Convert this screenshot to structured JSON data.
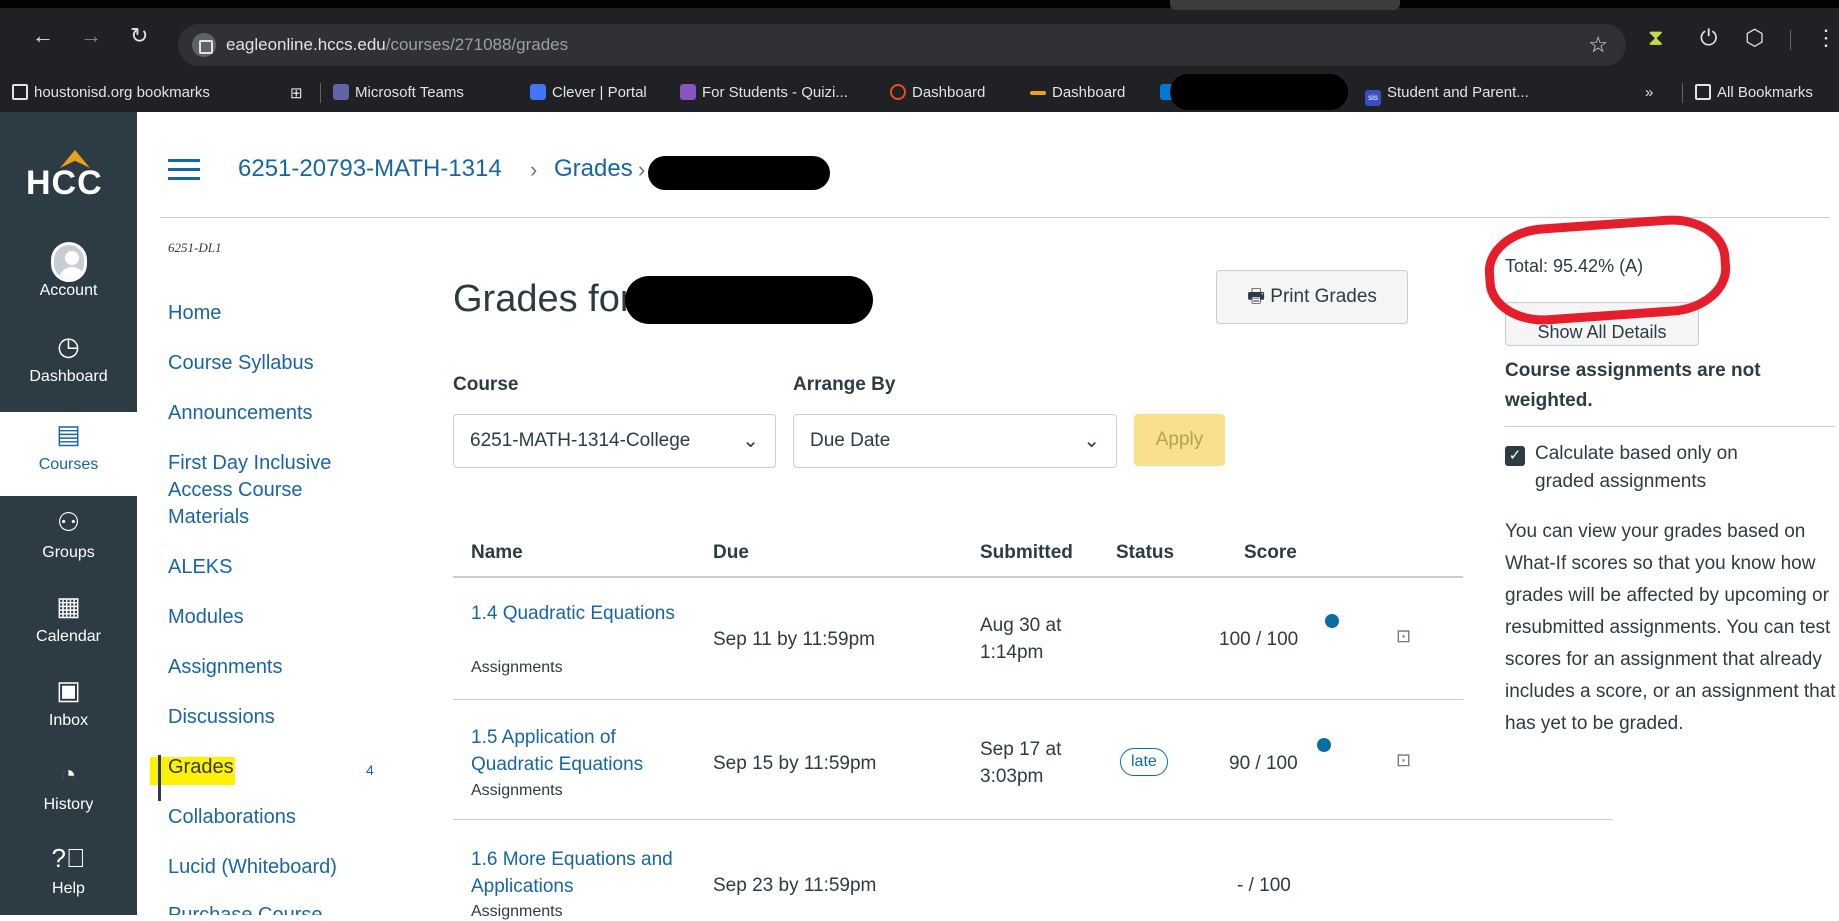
{
  "browser": {
    "url_domain": "eagleonline.hccs.edu",
    "url_path": "/courses/271088/grades",
    "bookmarks": [
      {
        "label": "houstonisd.org bookmarks"
      },
      {
        "label": "Microsoft Teams"
      },
      {
        "label": "Clever | Portal"
      },
      {
        "label": "For Students - Quizi..."
      },
      {
        "label": "Dashboard"
      },
      {
        "label": "Dashboard"
      },
      {
        "label": "Student and Parent..."
      },
      {
        "label": "»"
      },
      {
        "label": "All Bookmarks"
      }
    ]
  },
  "global_nav": {
    "logo": "HCC",
    "items": [
      {
        "label": "Account",
        "icon": "account-icon"
      },
      {
        "label": "Dashboard",
        "icon": "dashboard-icon"
      },
      {
        "label": "Courses",
        "icon": "courses-icon"
      },
      {
        "label": "Groups",
        "icon": "groups-icon"
      },
      {
        "label": "Calendar",
        "icon": "calendar-icon"
      },
      {
        "label": "Inbox",
        "icon": "inbox-icon"
      },
      {
        "label": "History",
        "icon": "history-icon"
      },
      {
        "label": "Help",
        "icon": "help-icon"
      }
    ]
  },
  "breadcrumb": {
    "course": "6251-20793-MATH-1314",
    "sep": "›",
    "page": "Grades"
  },
  "course_nav": {
    "term": "6251-DL1",
    "items": [
      {
        "label": "Home"
      },
      {
        "label": "Course Syllabus"
      },
      {
        "label": "Announcements"
      },
      {
        "label": "First Day Inclusive Access Course Materials"
      },
      {
        "label": "ALEKS"
      },
      {
        "label": "Modules"
      },
      {
        "label": "Assignments"
      },
      {
        "label": "Discussions"
      },
      {
        "label": "Grades"
      },
      {
        "label": "Collaborations"
      },
      {
        "label": "Lucid (Whiteboard)"
      },
      {
        "label": "Purchase Course"
      }
    ],
    "grades_count": "4"
  },
  "main": {
    "title": "Grades for",
    "print_label": "Print Grades",
    "course_label": "Course",
    "course_value": "6251-MATH-1314-College",
    "arrange_label": "Arrange By",
    "arrange_value": "Due Date",
    "apply_label": "Apply",
    "columns": [
      "Name",
      "Due",
      "Submitted",
      "Status",
      "Score"
    ],
    "rows": [
      {
        "name": "1.4 Quadratic Equations",
        "category": "Assignments",
        "due": "Sep 11 by 11:59pm",
        "submitted_1": "Aug 30 at",
        "submitted_2": "1:14pm",
        "status": "",
        "score": "100 / 100"
      },
      {
        "name": "1.5 Application of Quadratic Equations",
        "category": "Assignments",
        "due": "Sep 15 by 11:59pm",
        "submitted_1": "Sep 17 at",
        "submitted_2": "3:03pm",
        "status": "late",
        "score": "90 / 100"
      },
      {
        "name": "1.6 More Equations and Applications",
        "category": "Assignments",
        "due": "Sep 23 by 11:59pm",
        "submitted_1": "",
        "submitted_2": "",
        "status": "",
        "score": "- / 100"
      }
    ]
  },
  "sidebar": {
    "total": "Total: 95.42% (A)",
    "show_details": "Show All Details",
    "weighted_note": "Course assignments are not weighted.",
    "checkbox_label": "Calculate based only on graded assignments",
    "checkbox_checked": true,
    "whatif_text": "You can view your grades based on What-If scores so that you know how grades will be affected by upcoming or resubmitted assignments. You can test scores for an assignment that already includes a score, or an assignment that has yet to be graded."
  },
  "colors": {
    "link": "#1865a6",
    "nav_bg": "#2d3b45",
    "annotation_red": "#e61e2b",
    "highlight": "#fff200"
  }
}
